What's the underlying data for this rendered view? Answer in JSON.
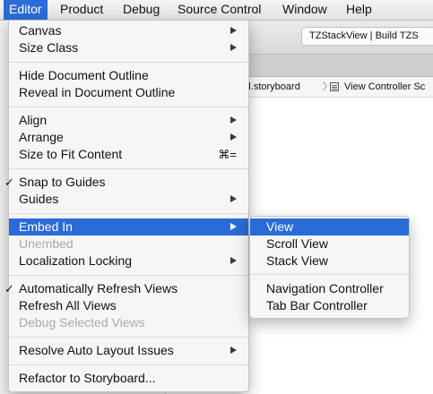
{
  "menubar": {
    "items": [
      "Editor",
      "Product",
      "Debug",
      "Source Control",
      "Window",
      "Help"
    ]
  },
  "window": {
    "activity_text": "TZStackView  |  Build TZS",
    "jump_crumb_1": "rd.storyboard",
    "jump_sep": "〉",
    "jump_crumb_2": "View Controller Sc"
  },
  "editor_menu": {
    "canvas": "Canvas",
    "size_class": "Size Class",
    "hide_outline": "Hide Document Outline",
    "reveal_outline": "Reveal in Document Outline",
    "align": "Align",
    "arrange": "Arrange",
    "size_to_fit": "Size to Fit Content",
    "size_to_fit_shortcut": "⌘=",
    "checkmark": "✓",
    "snap_to_guides": "Snap to Guides",
    "guides": "Guides",
    "embed_in": "Embed In",
    "unembed": "Unembed",
    "localization_locking": "Localization Locking",
    "auto_refresh": "Automatically Refresh Views",
    "refresh_all": "Refresh All Views",
    "debug_selected": "Debug Selected Views",
    "resolve_auto_layout": "Resolve Auto Layout Issues",
    "refactor": "Refactor to Storyboard..."
  },
  "embed_submenu": {
    "items": [
      "View",
      "Scroll View",
      "Stack View",
      "Navigation Controller",
      "Tab Bar Controller"
    ]
  }
}
